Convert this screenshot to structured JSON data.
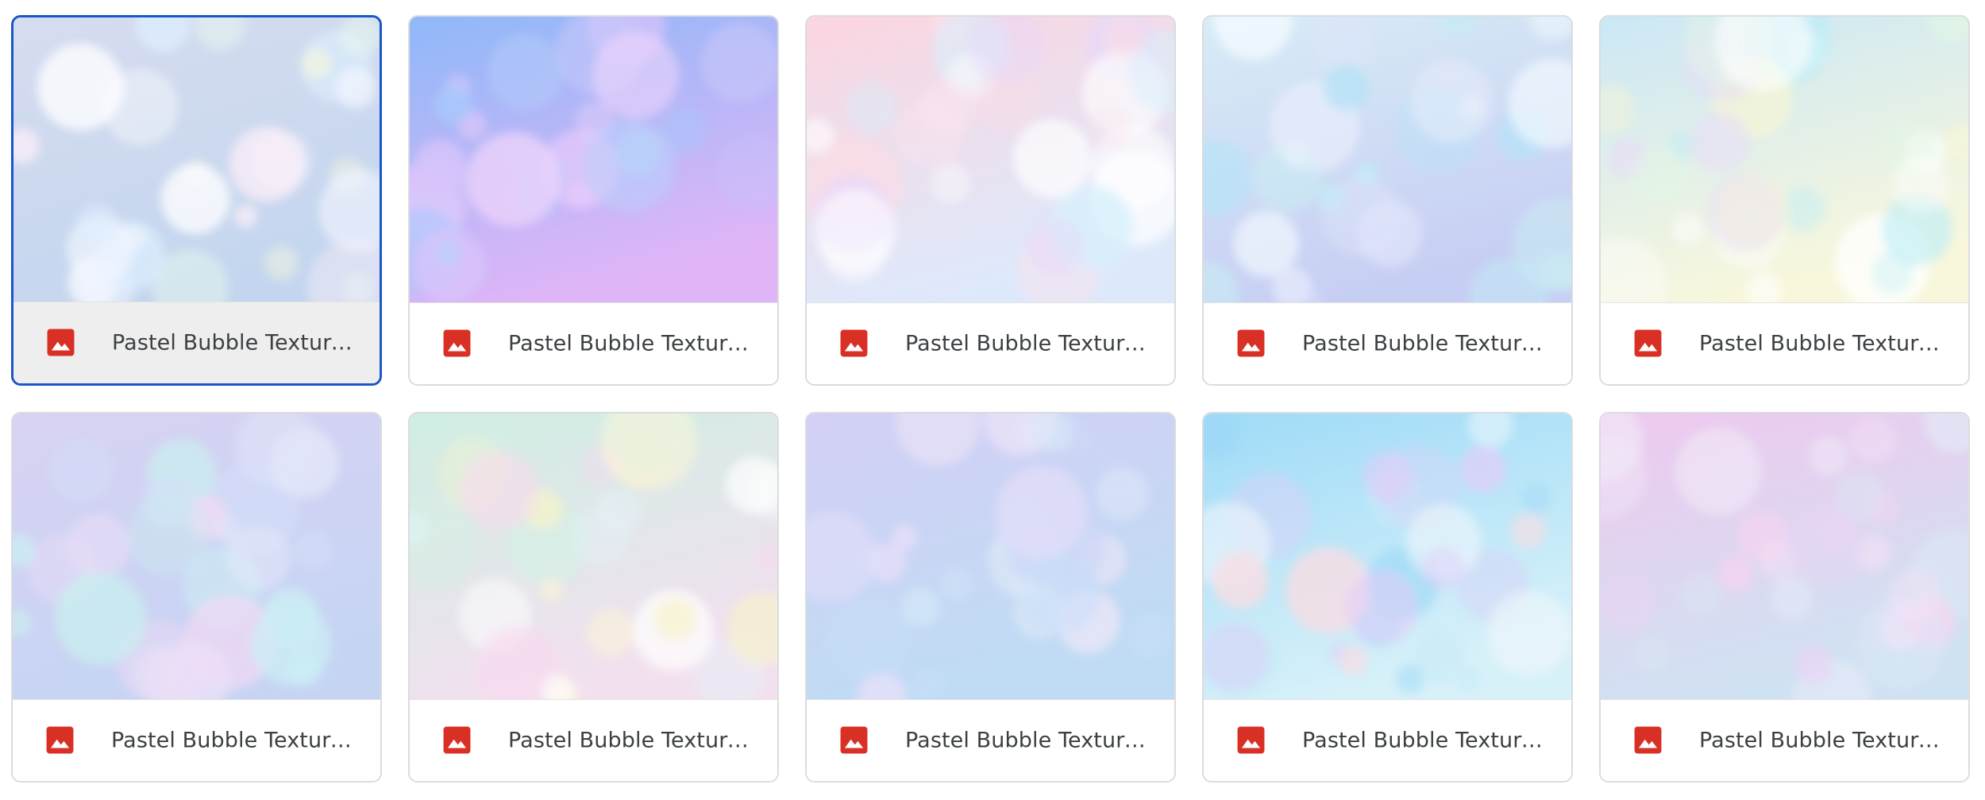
{
  "files": [
    {
      "name": "Pastel Bubble Texture ...",
      "type_icon": "image-file-icon",
      "selected": true,
      "palette": {
        "base_top": "#d6dcef",
        "base_bottom": "#c4d6ef",
        "bubbles": [
          "#ffffff",
          "#f2f6ff",
          "#e6f8ee",
          "#fbeef7",
          "#f6f9dc",
          "#ddeefe"
        ]
      }
    },
    {
      "name": "Pastel Bubble Texture ...",
      "type_icon": "image-file-icon",
      "selected": false,
      "palette": {
        "base_top": "#8fb8f8",
        "base_bottom": "#dfb5f7",
        "bubbles": [
          "#b9d2fb",
          "#c7c6fa",
          "#e3c8fb",
          "#a9c8fb",
          "#d9c4fb",
          "#eed4fb"
        ]
      }
    },
    {
      "name": "Pastel Bubble Texture ...",
      "type_icon": "image-file-icon",
      "selected": false,
      "palette": {
        "base_top": "#fbd5e0",
        "base_bottom": "#dde9fb",
        "bubbles": [
          "#ffffff",
          "#fbdde6",
          "#d7f0fb",
          "#e6d7fa",
          "#ffffff",
          "#f8e3ee"
        ]
      }
    },
    {
      "name": "Pastel Bubble Texture ...",
      "type_icon": "image-file-icon",
      "selected": false,
      "palette": {
        "base_top": "#d8ecf6",
        "base_bottom": "#c7cef3",
        "bubbles": [
          "#f5fbff",
          "#bfeef6",
          "#dfe4fb",
          "#c9f4f4",
          "#e9eefc",
          "#b6e3f6"
        ]
      }
    },
    {
      "name": "Pastel Bubble Texture ...",
      "type_icon": "image-file-icon",
      "selected": false,
      "palette": {
        "base_top": "#cbe7f6",
        "base_bottom": "#f8f7dc",
        "bubbles": [
          "#ffffff",
          "#b9ecf7",
          "#f7f6d3",
          "#e8dcf8",
          "#e1f7e4",
          "#ffffff"
        ]
      }
    },
    {
      "name": "Pastel Bubble Texture ...",
      "type_icon": "image-file-icon",
      "selected": false,
      "palette": {
        "base_top": "#d8d2f2",
        "base_bottom": "#c6d4f4",
        "bubbles": [
          "#e4e8fa",
          "#cbeff4",
          "#f0d9f4",
          "#d4e0f9",
          "#c9f0ef",
          "#ebdef8"
        ]
      }
    },
    {
      "name": "Pastel Bubble Texture ...",
      "type_icon": "image-file-icon",
      "selected": false,
      "palette": {
        "base_top": "#cfeee3",
        "base_bottom": "#f2e0ef",
        "bubbles": [
          "#ffffff",
          "#f7f2c9",
          "#d5efe4",
          "#f9d9ef",
          "#e4f3f9",
          "#fbf3d8"
        ]
      }
    },
    {
      "name": "Pastel Bubble Texture ...",
      "type_icon": "image-file-icon",
      "selected": false,
      "palette": {
        "base_top": "#d3cff5",
        "base_bottom": "#bfdcf4",
        "bubbles": [
          "#e8e0fa",
          "#c8def8",
          "#f1e8f8",
          "#d6e9f9",
          "#cdd7f6",
          "#eef4fb"
        ]
      }
    },
    {
      "name": "Pastel Bubble Texture ...",
      "type_icon": "image-file-icon",
      "selected": false,
      "palette": {
        "base_top": "#9fdbf7",
        "base_bottom": "#d7f1f9",
        "bubbles": [
          "#9fd8f6",
          "#e2cdf8",
          "#f8dde3",
          "#c8ebf7",
          "#d9d2f7",
          "#eef6fb"
        ]
      }
    },
    {
      "name": "Pastel Bubble Texture ...",
      "type_icon": "image-file-icon",
      "selected": false,
      "palette": {
        "base_top": "#efc8ef",
        "base_bottom": "#cfe2f2",
        "bubbles": [
          "#f6e2f6",
          "#e9d4f5",
          "#f1eaf8",
          "#e2e8f6",
          "#f7d4f0",
          "#dce6f4"
        ]
      }
    }
  ],
  "colors": {
    "selection_border": "#1a56c9",
    "card_border": "#dadce0",
    "file_icon_red": "#d93025",
    "label_text": "#3c4043"
  }
}
